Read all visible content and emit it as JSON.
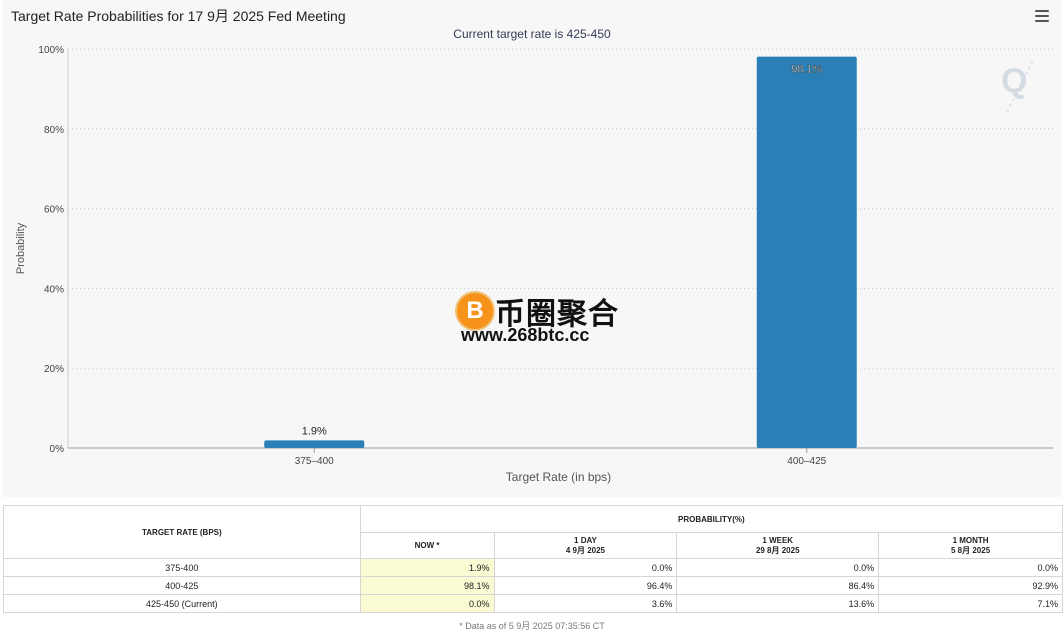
{
  "chart": {
    "title": "Target Rate Probabilities for 17 9月 2025 Fed Meeting",
    "subtitle": "Current target rate is 425-450",
    "ylabel": "Probability",
    "xlabel": "Target Rate (in bps)",
    "watermark": "Q"
  },
  "chart_data": {
    "type": "bar",
    "title": "Target Rate Probabilities for 17 9月 2025 Fed Meeting",
    "subtitle": "Current target rate is 425-450",
    "xlabel": "Target Rate (in bps)",
    "ylabel": "Probability",
    "categories": [
      "375–400",
      "400–425"
    ],
    "values": [
      1.9,
      98.1
    ],
    "data_labels": [
      "1.9%",
      "98.1%"
    ],
    "yticks": [
      "0%",
      "20%",
      "40%",
      "60%",
      "80%",
      "100%"
    ],
    "ylim": [
      0,
      100
    ],
    "grid": true,
    "bar_color": "#2a7fb6"
  },
  "logo": {
    "glyph": "B",
    "name": "币圈聚合",
    "url": "www.268btc.cc"
  },
  "table": {
    "header_target": "TARGET RATE (BPS)",
    "header_prob": "PROBABILITY(%)",
    "col_now": "NOW *",
    "col_day": "1 DAY",
    "col_day_date": "4 9月 2025",
    "col_week": "1 WEEK",
    "col_week_date": "29 8月 2025",
    "col_month": "1 MONTH",
    "col_month_date": "5 8月 2025",
    "rows": [
      {
        "rate": "375-400",
        "now": "1.9%",
        "day": "0.0%",
        "week": "0.0%",
        "month": "0.0%"
      },
      {
        "rate": "400-425",
        "now": "98.1%",
        "day": "96.4%",
        "week": "86.4%",
        "month": "92.9%"
      },
      {
        "rate": "425-450 (Current)",
        "now": "0.0%",
        "day": "3.6%",
        "week": "13.6%",
        "month": "7.1%"
      }
    ],
    "footnote": "* Data as of 5 9月 2025 07:35:56 CT"
  }
}
